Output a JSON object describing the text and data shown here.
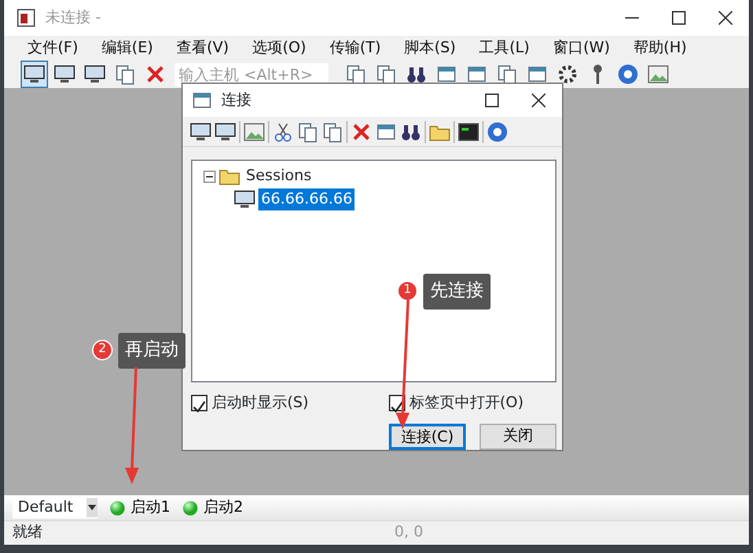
{
  "window": {
    "title": "未连接 -"
  },
  "menu": [
    "文件(F)",
    "编辑(E)",
    "查看(V)",
    "选项(O)",
    "传输(T)",
    "脚本(S)",
    "工具(L)",
    "窗口(W)",
    "帮助(H)"
  ],
  "quick_connect": {
    "placeholder": "输入主机 <Alt+R>"
  },
  "dialog": {
    "title": "连接",
    "tree": [
      {
        "label": "Sessions",
        "expanded": true,
        "selected": false,
        "children": [
          {
            "label": "66.66.66.66",
            "selected": true
          }
        ]
      }
    ],
    "checkboxes": [
      {
        "label": "启动时显示(S)",
        "checked": true
      },
      {
        "label": "标签页中打开(O)",
        "checked": true
      }
    ],
    "buttons": [
      {
        "label": "连接(C)",
        "default": true
      },
      {
        "label": "关闭",
        "default": false
      }
    ]
  },
  "annotations": [
    {
      "number": "1",
      "text": "先连接"
    },
    {
      "number": "2",
      "text": "再启动"
    }
  ],
  "button_bar": {
    "session": "Default",
    "buttons": [
      "启动1",
      "启动2"
    ]
  },
  "status_bar": {
    "message": "就绪",
    "position": "0, 0"
  }
}
